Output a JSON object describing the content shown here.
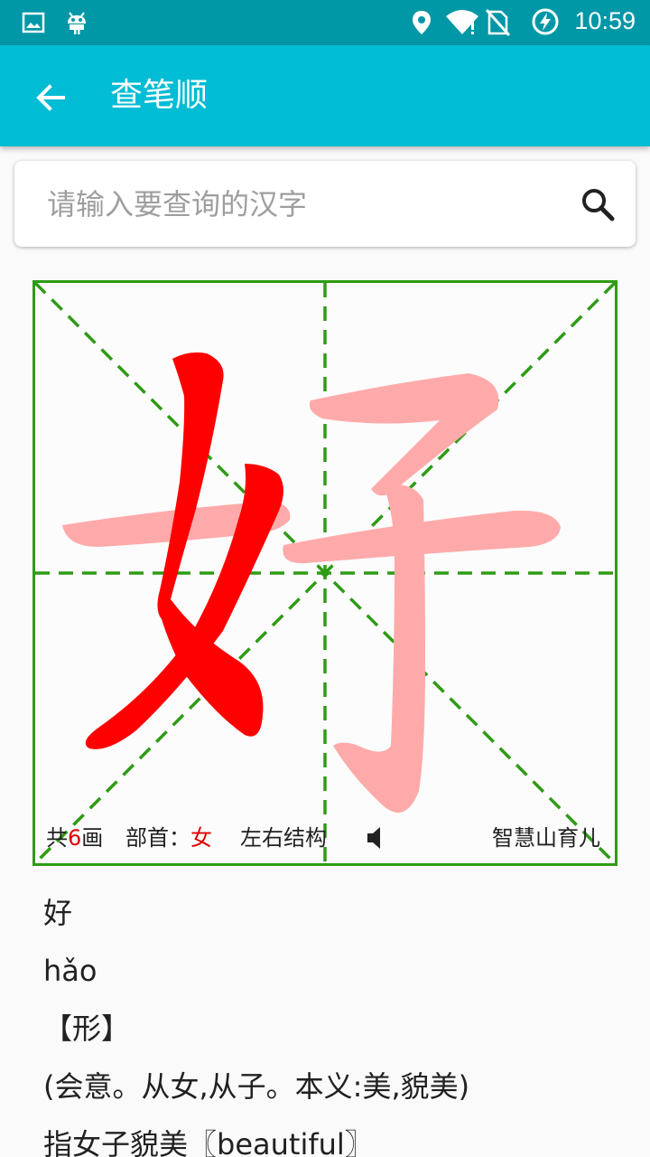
{
  "status_bar": {
    "time": "10:59",
    "icons": [
      "image-icon",
      "android-icon",
      "location-icon",
      "wifi-icon",
      "no-sim-icon",
      "battery-charging-icon"
    ]
  },
  "app_bar": {
    "title": "查笔顺",
    "back_icon": "arrow-left-icon"
  },
  "search": {
    "placeholder": "请输入要查询的汉字",
    "value": "",
    "icon": "search-icon"
  },
  "character_card": {
    "character": "好",
    "stroke_prefix": "共",
    "stroke_count": "6",
    "stroke_suffix": "画",
    "radical_label": "部首：",
    "radical": "女",
    "structure": "左右结构",
    "speaker_icon": "speaker-icon",
    "brand": "智慧山育儿",
    "colors": {
      "grid": "#2e9b15",
      "written_stroke": "#ff0000",
      "pending_stroke": "#ffaaaa"
    }
  },
  "details": {
    "character": "好",
    "pinyin": "hǎo",
    "category": "【形】",
    "etymology": "(会意。从女,从子。本义:美,貌美)",
    "meaning": "指女子貌美〖beautiful〗"
  }
}
